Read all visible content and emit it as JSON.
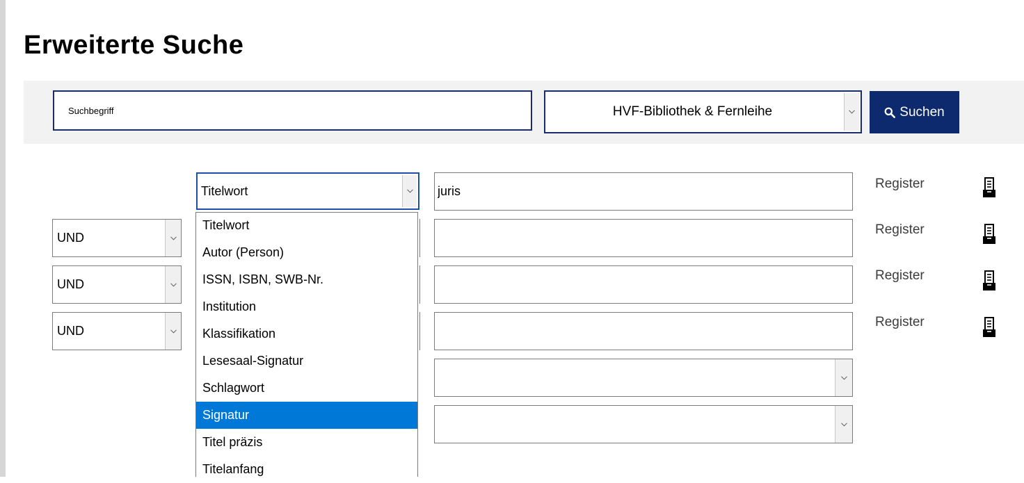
{
  "page_title": "Erweiterte Suche",
  "search_bar": {
    "term_placeholder": "Suchbegriff",
    "scope_value": "HVF-Bibliothek & Fernleihe",
    "search_button_label": "Suchen"
  },
  "criteria": {
    "field_select_value": "Titelwort",
    "rows": [
      {
        "operator": "",
        "value": "juris",
        "register_label": "Register"
      },
      {
        "operator": "UND",
        "value": "",
        "register_label": "Register"
      },
      {
        "operator": "UND",
        "value": "",
        "register_label": "Register"
      },
      {
        "operator": "UND",
        "value": "",
        "register_label": "Register"
      }
    ]
  },
  "dropdown": {
    "options": [
      "Titelwort",
      "Autor (Person)",
      "ISSN, ISBN, SWB-Nr.",
      "Institution",
      "Klassifikation",
      "Lesesaal-Signatur",
      "Schlagwort",
      "Signatur",
      "Titel präzis",
      "Titelanfang"
    ],
    "highlighted": "Signatur"
  },
  "colors": {
    "primary_navy": "#0d2a6e",
    "field_border_blue": "#1c50a8",
    "dropdown_highlight": "#0078d7",
    "search_band_bg": "#f2f2f2"
  },
  "icons": {
    "search_button": "search-icon",
    "register": "card-index-icon",
    "select": "chevron-down-icon"
  }
}
